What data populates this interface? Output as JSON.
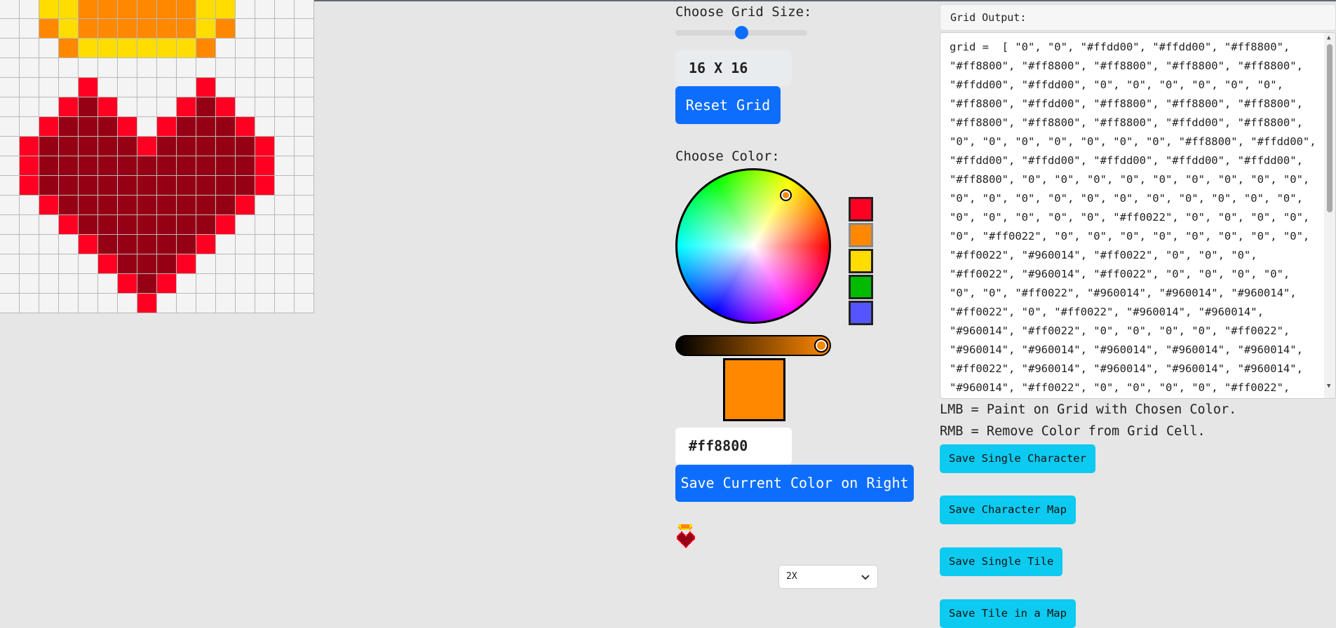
{
  "grid": {
    "size": 16,
    "palette": {
      "0": "#f4f4f4",
      "y": "#ffdd00",
      "o": "#ff8800",
      "r": "#ff0022",
      "d": "#960014"
    },
    "rows": [
      "00yyooooooyy0000",
      "00yyooooooyy0000",
      "00oyooooooyo0000",
      "000oyyyyyyo00000",
      "0000000000000000",
      "0000r00000r00000",
      "000rdr000rdr0000",
      "00rdddr0rdddr000",
      "0rdddddrdddddr00",
      "0rdddddddddddr00",
      "0rdddddddddddr00",
      "00rdddddddddr000",
      "000rdddddddr0000",
      "0000rdddddr00000",
      "00000rdddr000000",
      "000000rdr0000000",
      "0000000r00000000"
    ]
  },
  "controls": {
    "grid_size_label": "Choose Grid Size:",
    "grid_size_slider_fraction": 0.5,
    "grid_size_display": "16 X 16",
    "reset_button": "Reset Grid",
    "color_label": "Choose Color:",
    "wheel_hue_deg": 32,
    "wheel_saturation": 0.8,
    "saved_swatches": [
      "#ff0022",
      "#ff8800",
      "#ffdd00",
      "#00bb00",
      "#5555ff"
    ],
    "brightness_fraction": 1.0,
    "current_color": "#ff8800",
    "hex_value": "#ff8800",
    "save_color_button": "Save Current Color on Right",
    "scale_select_value": "2X"
  },
  "output": {
    "title": "Grid Output:",
    "text": "grid =  [ \"0\", \"0\", \"#ffdd00\", \"#ffdd00\", \"#ff8800\", \"#ff8800\", \"#ff8800\", \"#ff8800\", \"#ff8800\", \"#ff8800\", \"#ffdd00\", \"#ffdd00\", \"0\", \"0\", \"0\", \"0\", \"0\", \"0\", \"#ff8800\", \"#ffdd00\", \"#ff8800\", \"#ff8800\", \"#ff8800\", \"#ff8800\", \"#ff8800\", \"#ff8800\", \"#ffdd00\", \"#ff8800\", \"0\", \"0\", \"0\", \"0\", \"0\", \"0\", \"0\", \"#ff8800\", \"#ffdd00\", \"#ffdd00\", \"#ffdd00\", \"#ffdd00\", \"#ffdd00\", \"#ffdd00\", \"#ff8800\", \"0\", \"0\", \"0\", \"0\", \"0\", \"0\", \"0\", \"0\", \"0\", \"0\", \"0\", \"0\", \"0\", \"0\", \"0\", \"0\", \"0\", \"0\", \"0\", \"0\", \"0\", \"0\", \"0\", \"0\", \"0\", \"#ff0022\", \"0\", \"0\", \"0\", \"0\", \"0\", \"#ff0022\", \"0\", \"0\", \"0\", \"0\", \"0\", \"0\", \"0\", \"0\", \"#ff0022\", \"#960014\", \"#ff0022\", \"0\", \"0\", \"0\", \"#ff0022\", \"#960014\", \"#ff0022\", \"0\", \"0\", \"0\", \"0\", \"0\", \"0\", \"#ff0022\", \"#960014\", \"#960014\", \"#960014\", \"#ff0022\", \"0\", \"#ff0022\", \"#960014\", \"#960014\", \"#960014\", \"#ff0022\", \"0\", \"0\", \"0\", \"0\", \"#ff0022\", \"#960014\", \"#960014\", \"#960014\", \"#960014\", \"#960014\", \"#ff0022\", \"#960014\", \"#960014\", \"#960014\", \"#960014\", \"#960014\", \"#ff0022\", \"0\", \"0\", \"0\", \"0\", \"#ff0022\","
  },
  "hints": {
    "lmb": "LMB = Paint on Grid with Chosen Color.",
    "rmb": "RMB = Remove Color from Grid Cell."
  },
  "actions": {
    "save_single_character": "Save Single Character",
    "save_character_map": "Save Character Map",
    "save_single_tile": "Save Single Tile",
    "save_tile_in_map": "Save Tile in a Map"
  }
}
